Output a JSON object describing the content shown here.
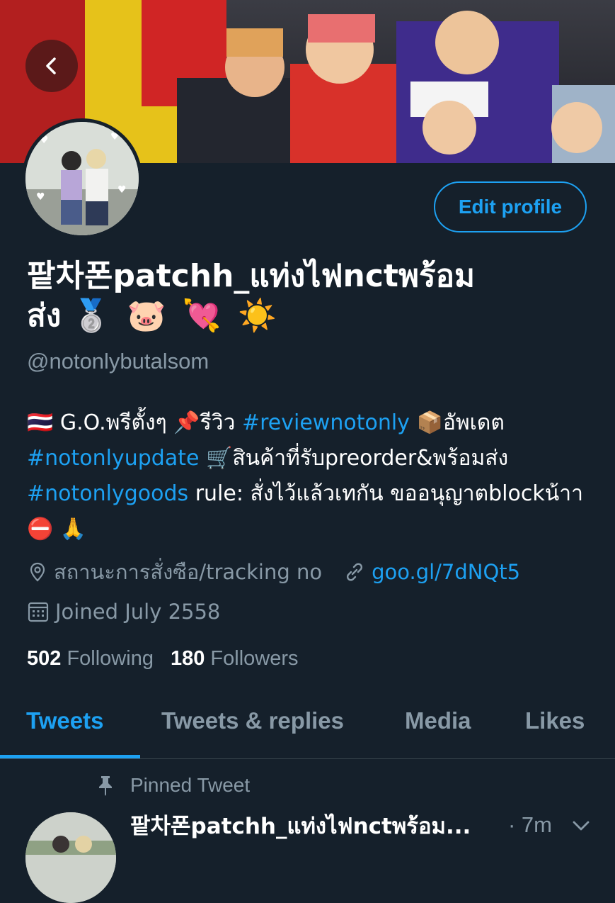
{
  "profile": {
    "display_name_line1": "팥차폰patchh_แท่งไฟnctพร้อม",
    "display_name_line2": "ส่ง",
    "display_name_emoji": "🥈 🐷 💘 ☀️",
    "handle": "@notonlybutalsom",
    "edit_profile_label": "Edit profile"
  },
  "bio": {
    "flag": "🇹🇭",
    "part1": " G.O.พรีตั้งๆ ",
    "pin": "📌",
    "part2": "รีวิว ",
    "tag1": "#reviewnotonly",
    "box": " 📦",
    "part3": "อัพเดต ",
    "tag2": "#notonlyupdate",
    "cart": " 🛒",
    "part4": "สินค้าที่รับpreorder&พร้อมส่ง ",
    "tag3": "#notonlygoods",
    "part5": " rule: สั่งไว้แล้วเทกัน ขออนุญาตblockน้าา",
    "end_emoji": "⛔ 🙏"
  },
  "meta": {
    "location": "สถานะการสั่งซือ/tracking no",
    "link": "goo.gl/7dNQt5",
    "joined": "Joined July 2558"
  },
  "counts": {
    "following_num": "502",
    "following_label": "Following",
    "followers_num": "180",
    "followers_label": "Followers"
  },
  "tabs": {
    "tweets": "Tweets",
    "replies": "Tweets & replies",
    "media": "Media",
    "likes": "Likes"
  },
  "pinned": {
    "label": "Pinned Tweet",
    "name": "팥차폰patchh_แท่งไฟnctพร้อม...",
    "time": "· 7m"
  },
  "colors": {
    "background": "#15202b",
    "accent": "#1da1f2",
    "muted": "#8899a6"
  },
  "icons": [
    "chevron-left-icon",
    "location-pin-icon",
    "link-icon",
    "calendar-icon",
    "pin-icon",
    "chevron-down-icon"
  ]
}
